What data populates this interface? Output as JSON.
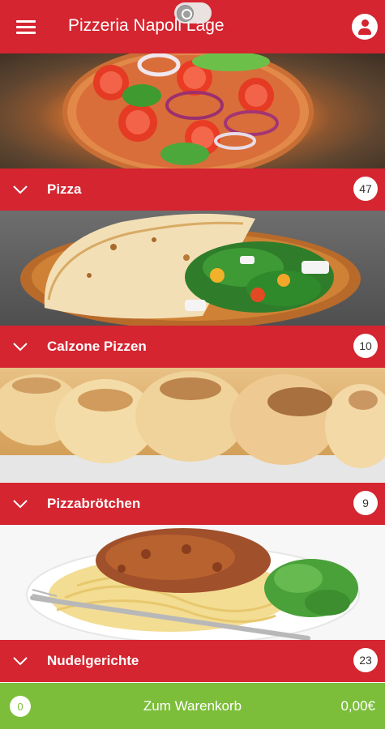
{
  "header": {
    "title": "Pizzeria Napoli Lage",
    "menu_icon": "hamburger-menu-icon",
    "whatsapp_icon": "whatsapp-icon",
    "profile_icon": "user-icon"
  },
  "categories": [
    {
      "label": "Pizza",
      "count": "47",
      "image": "pizza-photo"
    },
    {
      "label": "Calzone Pizzen",
      "count": "10",
      "image": "calzone-photo"
    },
    {
      "label": "Pizzabrötchen",
      "count": "9",
      "image": "pizza-rolls-photo"
    },
    {
      "label": "Nudelgerichte",
      "count": "23",
      "image": "spaghetti-bolognese-photo"
    }
  ],
  "cart": {
    "count": "0",
    "label": "Zum Warenkorb",
    "total": "0,00€"
  },
  "colors": {
    "primary_red": "#d42530",
    "cart_green": "#7cbe3a",
    "white": "#ffffff"
  }
}
